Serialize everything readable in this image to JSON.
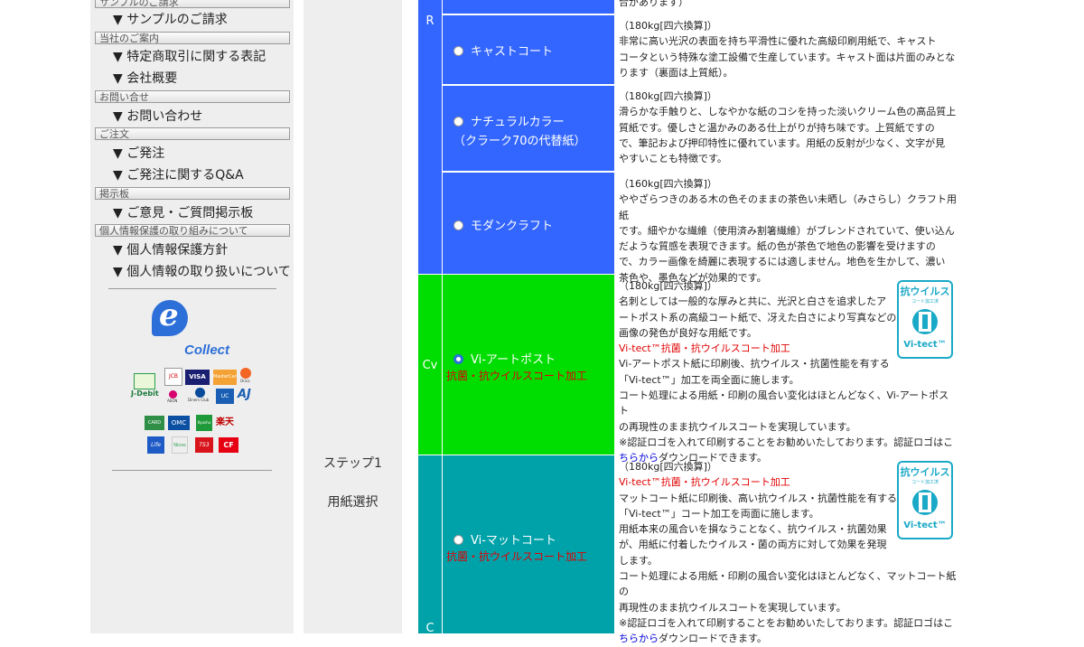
{
  "sidebar": {
    "top_head": "サンプルのご請求",
    "items": [
      {
        "label": "▼ サンプルのご請求"
      },
      {
        "head": "当社のご案内"
      },
      {
        "label": "▼ 特定商取引に関する表記"
      },
      {
        "label": "▼ 会社概要"
      },
      {
        "head": "お問い合せ"
      },
      {
        "label": "▼ お問い合わせ"
      },
      {
        "head": "ご注文"
      },
      {
        "label": "▼ ご発注"
      },
      {
        "label": "▼ ご発注に関するQ&A"
      },
      {
        "head": "掲示板"
      },
      {
        "label": "▼ ご意見・ご質問掲示板"
      },
      {
        "head": "個人情報保護の取り組みについて"
      },
      {
        "label": "▼ 個人情報保護方針"
      },
      {
        "label": "▼ 個人情報の取り扱いについて"
      }
    ],
    "ecollect": {
      "letter": "e",
      "text": "Collect"
    },
    "payment_logos": [
      "J-Debit",
      "JCB",
      "VISA",
      "MasterCard",
      "Orico",
      "AEON",
      "Diners Club",
      "UC",
      "AJ",
      "CARD",
      "OMC",
      "Kyushu",
      "楽天",
      "Life",
      "Nicos",
      "TS3",
      "CF"
    ]
  },
  "step": {
    "step_label": "ステップ1",
    "title": "用紙選択"
  },
  "table": {
    "top_note": "合があります）",
    "groups": [
      {
        "code": "R",
        "color": "#3366ff"
      },
      {
        "code": "Cv",
        "color": "#00dd00"
      },
      {
        "code": "C",
        "color": "#00a2aa"
      }
    ],
    "papers": [
      {
        "name": "キャストコート",
        "selected": false,
        "lines": [
          "（180kg[四六換算]）",
          "非常に高い光沢の表面を持ち平滑性に優れた高級印刷用紙で、キャスト",
          "コータという特殊な塗工設備で生産しています。キャスト面は片面のみとな",
          "ります（裏面は上質紙）。"
        ]
      },
      {
        "name": "ナチュラルカラー",
        "name2": "（クラーク70の代替紙）",
        "selected": false,
        "lines": [
          "（180kg[四六換算]）",
          "滑らかな手触りと、しなやかな紙のコシを持った淡いクリーム色の高品質上",
          "質紙です。優しさと温かみのある仕上がりが持ち味です。上質紙ですの",
          "で、筆記および押印特性に優れています。用紙の反射が少なく、文字が見",
          "やすいことも特徴です。"
        ]
      },
      {
        "name": "モダンクラフト",
        "selected": false,
        "lines": [
          "（160kg[四六換算]）",
          "ややざらつきのある木の色そのままの茶色い未晒し（みさらし）クラフト用紙",
          "です。細やかな繊維（使用済み割箸繊維）がブレンドされていて、使い込ん",
          "だような質感を表現できます。紙の色が茶色で地色の影響を受けますの",
          "で、カラー画像を綺麗に表現するには適しません。地色を生かして、濃い",
          "茶色や、墨色などが効果的です。"
        ]
      },
      {
        "name": "Vi-アートポスト",
        "sub": "抗菌・抗ウイルスコート加工",
        "selected": true,
        "lines": [
          "（180kg[四六換算]）",
          "名刺としては一般的な厚みと共に、光沢と白さを追求したア",
          "ートポスト系の高級コート紙で、冴えた白さにより写真などの",
          "画像の発色が良好な用紙です。"
        ],
        "red": "Vi-tect™抗菌・抗ウイルスコート加工",
        "lines2": [
          "Vi-アートポスト紙に印刷後、抗ウイルス・抗菌性能を有する",
          "「Vi-tect™」加工を両全面に施します。",
          "コート処理による用紙・印刷の風合い変化はほとんどなく、Vi-アートポスト",
          "の再現性のまま抗ウイルスコートを実現しています。",
          "※認証ロゴを入れて印刷することをお勧めいたしております。認証ロゴはこ"
        ],
        "link": "ちらから",
        "after_link": "ダウンロードできます。"
      },
      {
        "name": "Vi-マットコート",
        "sub": "抗菌・抗ウイルスコート加工",
        "selected": false,
        "lines": [
          "（180kg[四六換算]）"
        ],
        "red": "Vi-tect™抗菌・抗ウイルスコート加工",
        "lines2": [
          "マットコート紙に印刷後、高い抗ウイルス・抗菌性能を有する",
          "「Vi-tect™」コート加工を両面に施します。",
          "用紙本来の風合いを損なうことなく、抗ウイルス・抗菌効果",
          "が、用紙に付着したウイルス・菌の両方に対して効果を発現",
          "します。",
          "コート処理による用紙・印刷の風合い変化はほとんどなく、マットコート紙の",
          "再現性のまま抗ウイルスコートを実現しています。",
          "※認証ロゴを入れて印刷することをお勧めいたしております。認証ロゴはこ"
        ],
        "link": "ちらから",
        "after_link": "ダウンロードできます。"
      }
    ],
    "badge": {
      "top": "抗ウイルス",
      "mid": "コート加工済",
      "bottom": "Vi-tect™"
    }
  }
}
